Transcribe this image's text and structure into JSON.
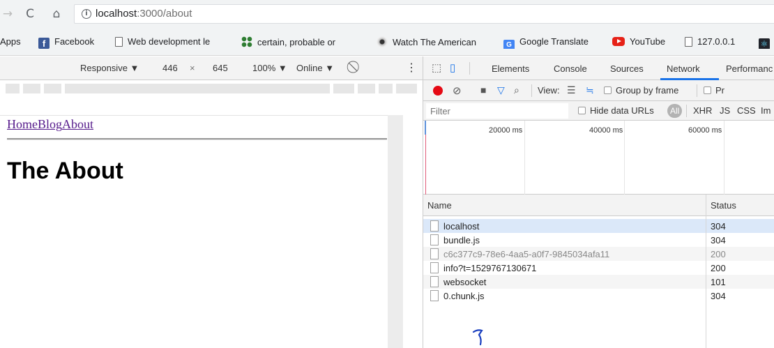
{
  "browser": {
    "url_host": "localhost",
    "url_path": ":3000/about",
    "back_icon": "back-arrow-icon",
    "reload_icon": "reload-icon",
    "home_icon": "home-icon"
  },
  "bookmarks": [
    {
      "label": "Apps",
      "icon": "apps-icon"
    },
    {
      "label": "Facebook",
      "icon": "facebook-icon"
    },
    {
      "label": "Web development le",
      "icon": "page-icon"
    },
    {
      "label": "certain, probable or",
      "icon": "dots-icon"
    },
    {
      "label": "Watch The American",
      "icon": "watch-icon"
    },
    {
      "label": "Google Translate",
      "icon": "google-translate-icon"
    },
    {
      "label": "YouTube",
      "icon": "youtube-icon"
    },
    {
      "label": "127.0.0.1",
      "icon": "page-icon"
    }
  ],
  "device_toolbar": {
    "device": "Responsive ▼",
    "width": "446",
    "times": "×",
    "height": "645",
    "zoom": "100% ▼",
    "network": "Online ▼",
    "more": "⋮"
  },
  "page": {
    "nav_links": [
      "Home",
      "Blog",
      "About"
    ],
    "heading": "The About"
  },
  "devtools": {
    "tabs": [
      "Elements",
      "Console",
      "Sources",
      "Network",
      "Performanc"
    ],
    "active_tab": "Network",
    "toolbar": {
      "view_label": "View:",
      "group_by_frame": "Group by frame",
      "preserve": "Pr"
    },
    "filter": {
      "placeholder": "Filter",
      "hide_data_urls": "Hide data URLs",
      "all": "All",
      "types": [
        "XHR",
        "JS",
        "CSS",
        "Im"
      ]
    },
    "timeline_ticks": [
      "20000 ms",
      "40000 ms",
      "60000 ms"
    ],
    "columns": {
      "name": "Name",
      "status": "Status"
    },
    "requests": [
      {
        "name": "localhost",
        "status": "304"
      },
      {
        "name": "bundle.js",
        "status": "304"
      },
      {
        "name": "c6c377c9-78e6-4aa5-a0f7-9845034afa11",
        "status": "200"
      },
      {
        "name": "info?t=1529767130671",
        "status": "200"
      },
      {
        "name": "websocket",
        "status": "101"
      },
      {
        "name": "0.chunk.js",
        "status": "304"
      }
    ]
  },
  "colors": {
    "record": "#e50914",
    "active_tab_underline": "#1a73e8",
    "selected_row": "#dbe8f9",
    "link_visited": "#551a8b"
  }
}
